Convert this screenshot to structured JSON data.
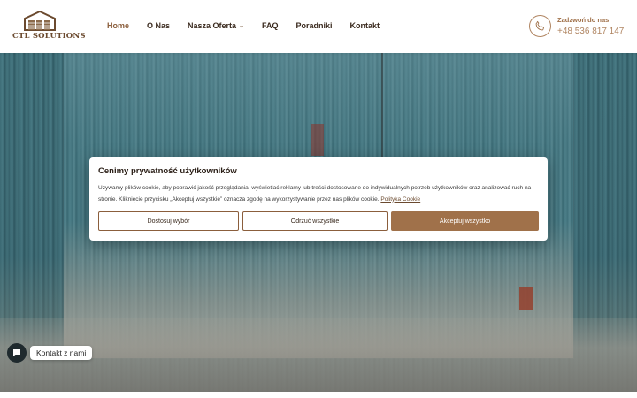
{
  "header": {
    "logo_text": "CTL SOLUTIONS",
    "nav": [
      {
        "label": "Home",
        "active": true
      },
      {
        "label": "O Nas"
      },
      {
        "label": "Nasza Oferta",
        "has_dropdown": true
      },
      {
        "label": "FAQ"
      },
      {
        "label": "Poradniki"
      },
      {
        "label": "Kontakt"
      }
    ],
    "call_label": "Zadzwoń do nas",
    "phone_number": "+48 536 817 147"
  },
  "cookie_banner": {
    "title": "Cenimy prywatność użytkowników",
    "text": "Używamy plików cookie, aby poprawić jakość przeglądania, wyświetlać reklamy lub treści dostosowane do indywidualnych potrzeb użytkowników oraz analizować ruch na stronie. Kliknięcie przycisku „Akceptuj wszystkie” oznacza zgodę na wykorzystywanie przez nas plików cookie.",
    "link_label": "Polityka Cookie",
    "buttons": {
      "customize": "Dostosuj wybór",
      "reject": "Odrzuć wszystkie",
      "accept": "Akceptuj wszystko"
    }
  },
  "contact_chip": {
    "label": "Kontakt z nami"
  },
  "colors": {
    "brand_brown": "#a0714a",
    "nav_text": "#3a2a1e",
    "chat_dark": "#1f2a2e"
  }
}
